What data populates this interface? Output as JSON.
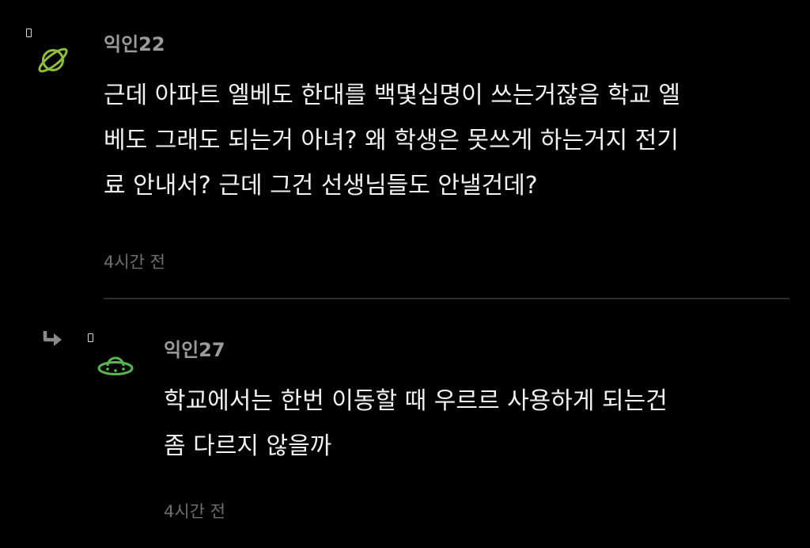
{
  "comments": [
    {
      "author": "익인22",
      "avatar_icon": "planet-icon",
      "avatar_color": "#8fbf3a",
      "lines": [
        "근데 아파트 엘베도 한대를 백몇십명이 쓰는거잖음 학교 엘",
        "베도 그래도 되는거 아녀? 왜 학생은 못쓰게 하는거지 전기",
        "료 안내서? 근데 그건 선생님들도 안낼건데?"
      ],
      "time": "4시간 전"
    },
    {
      "author": "익인27",
      "avatar_icon": "ufo-icon",
      "avatar_color": "#5ab552",
      "reply_icon": "reply-arrow-icon",
      "lines": [
        "학교에서는 한번 이동할 때 우르르 사용하게 되는건",
        "좀 다르지 않을까"
      ],
      "time": "4시간 전"
    }
  ]
}
